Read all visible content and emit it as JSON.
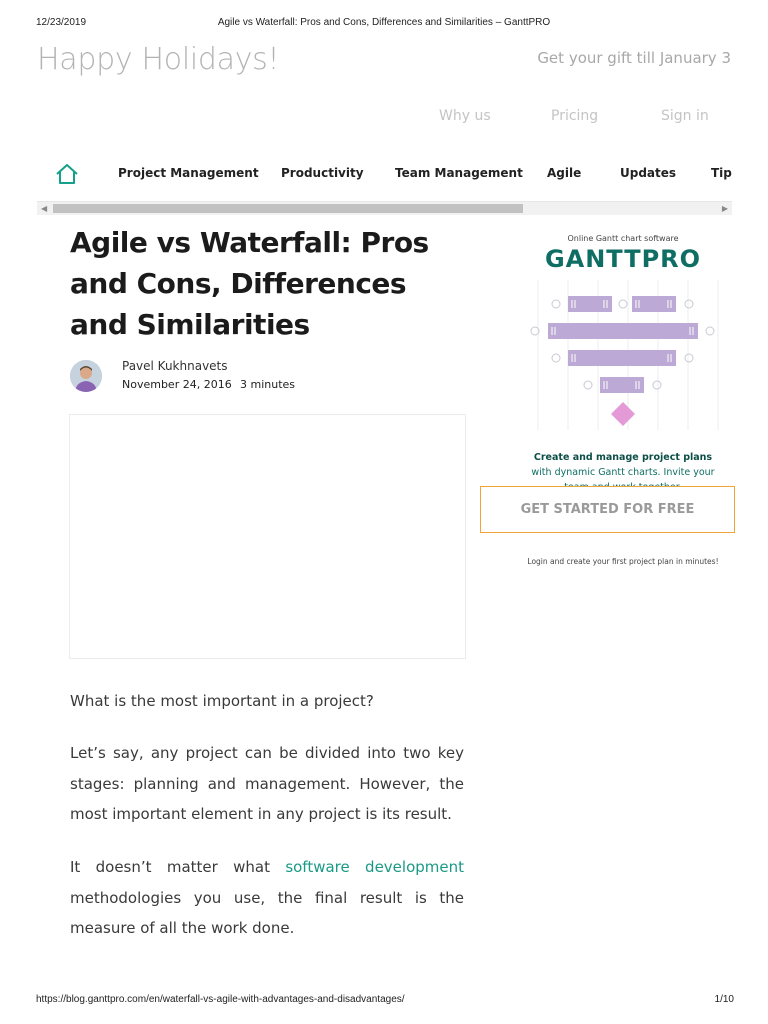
{
  "print_header": {
    "date": "12/23/2019",
    "title": "Agile vs Waterfall: Pros and Cons, Differences and Similarities – GanttPRO"
  },
  "promo": {
    "headline": "Happy Holidays!",
    "gift_text": "Get your gift till January 3"
  },
  "top_nav": {
    "why_us": "Why us",
    "pricing": "Pricing",
    "sign_in": "Sign in"
  },
  "category_nav": {
    "home_icon": "home-icon",
    "items": [
      "Project Management",
      "Productivity",
      "Team Management",
      "Agile",
      "Updates",
      "Tips"
    ]
  },
  "article": {
    "title": "Agile vs Waterfall: Pros and Cons, Differences and Similarities",
    "author": "Pavel Kukhnavets",
    "date": "November 24, 2016",
    "read_time": "3 minutes",
    "paragraphs": {
      "p1": "What is the most important in a project?",
      "p2": "Let’s say, any project can be divided into two key stages: planning and management. However, the most important element in any project is its result.",
      "p3_before": "It doesn’t matter what ",
      "p3_link": "software development",
      "p3_after": " methodologies you use, the final result is the measure of all the work done."
    }
  },
  "ad": {
    "tagline": "Online Gantt chart software",
    "logo": "GANTTPRO",
    "text_bold": "Create and manage project plans",
    "text_rest": " with dynamic Gantt charts. Invite your team and work together.",
    "cta": "GET STARTED FOR FREE",
    "footnote": "Login and create your first project plan in minutes!",
    "bar_color": "#bda9d6",
    "milestone_color": "#e39ad6"
  },
  "print_footer": {
    "url": "https://blog.ganttpro.com/en/waterfall-vs-agile-with-advantages-and-disadvantages/",
    "page": "1/10"
  }
}
